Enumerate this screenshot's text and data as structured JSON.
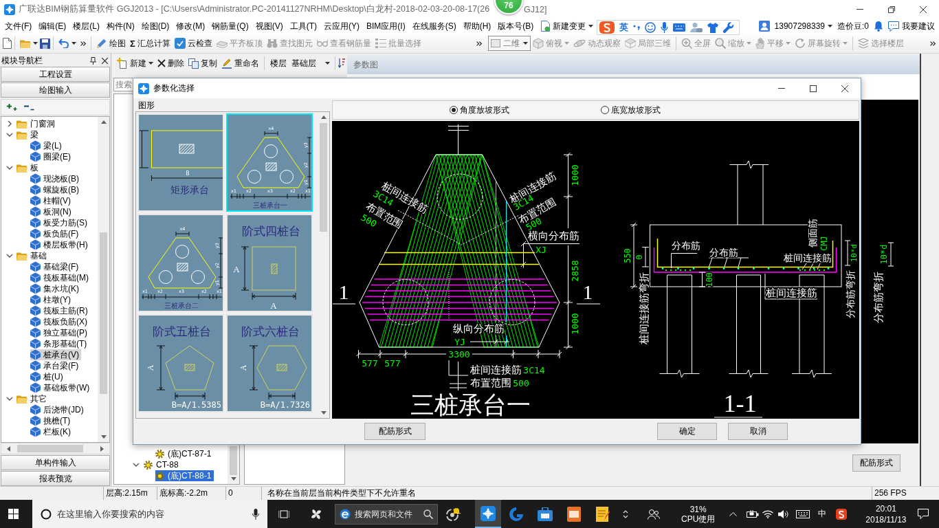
{
  "window": {
    "title": "广联达BIM钢筋算量软件 GGJ2013 - [C:\\Users\\Administrator.PC-20141127NRHM\\Desktop\\白龙村-2018-02-03-20-08-17(26",
    "title_tail": "GJ12]"
  },
  "score_badge": {
    "value": "76"
  },
  "menu": {
    "items": [
      "文件(F)",
      "编辑(E)",
      "楼层(L)",
      "构件(N)",
      "绘图(D)",
      "修改(M)",
      "钢筋量(Q)",
      "视图(V)",
      "工具(T)",
      "云应用(Y)",
      "BIM应用(I)",
      "在线服务(S)",
      "帮助(H)",
      "版本号(B)"
    ],
    "change": "新建变更"
  },
  "ime_toolbar": {
    "mode": "英"
  },
  "account": {
    "phone": "13907298339",
    "beans": "造价豆:0",
    "feedback": "我要建议"
  },
  "toolbar": {
    "main": [
      {
        "label": "绘图",
        "disabled": false
      },
      {
        "glyph": "Σ",
        "label": "汇总计算",
        "disabled": false
      },
      {
        "label": "云检查",
        "disabled": false
      },
      {
        "label": "平齐板顶",
        "disabled": true
      },
      {
        "label": "查找图元",
        "disabled": true
      },
      {
        "label": "查看钢筋量",
        "disabled": true
      },
      {
        "label": "批量选择",
        "disabled": true
      }
    ],
    "view_mode": {
      "value": "二维",
      "disabled": true
    },
    "view": [
      {
        "label": "俯视",
        "dropdown": true,
        "disabled": true
      },
      {
        "label": "动态观察",
        "dropdown": false,
        "disabled": true
      },
      {
        "label": "局部三维",
        "dropdown": false,
        "disabled": true
      },
      {
        "label": "全屏",
        "dropdown": false,
        "disabled": true
      },
      {
        "label": "缩放",
        "dropdown": true,
        "disabled": true
      },
      {
        "label": "平移",
        "dropdown": true,
        "disabled": true
      },
      {
        "label": "屏幕旋转",
        "dropdown": true,
        "disabled": true
      },
      {
        "label": "选择楼层",
        "dropdown": false,
        "disabled": true
      }
    ]
  },
  "nav": {
    "title": "模块导航栏",
    "top_buttons": [
      "工程设置",
      "绘图输入"
    ],
    "tree": [
      {
        "label": "门窗洞",
        "expanded": false
      },
      {
        "label": "梁",
        "expanded": true,
        "children": [
          {
            "label": "梁(L)",
            "selected": false
          },
          {
            "label": "圈梁(E)",
            "selected": false
          }
        ]
      },
      {
        "label": "板",
        "expanded": true,
        "children": [
          {
            "label": "现浇板(B)",
            "selected": false
          },
          {
            "label": "螺旋板(B)",
            "selected": false
          },
          {
            "label": "柱帽(V)",
            "selected": false
          },
          {
            "label": "板洞(N)",
            "selected": false
          },
          {
            "label": "板受力筋(S)",
            "selected": false
          },
          {
            "label": "板负筋(F)",
            "selected": false
          },
          {
            "label": "楼层板带(H)",
            "selected": false
          }
        ]
      },
      {
        "label": "基础",
        "expanded": true,
        "children": [
          {
            "label": "基础梁(F)",
            "selected": false
          },
          {
            "label": "筏板基础(M)",
            "selected": false
          },
          {
            "label": "集水坑(K)",
            "selected": false
          },
          {
            "label": "柱墩(Y)",
            "selected": false
          },
          {
            "label": "筏板主筋(R)",
            "selected": false
          },
          {
            "label": "筏板负筋(X)",
            "selected": false
          },
          {
            "label": "独立基础(P)",
            "selected": false
          },
          {
            "label": "条形基础(T)",
            "selected": false
          },
          {
            "label": "桩承台(V)",
            "selected": true
          },
          {
            "label": "承台梁(F)",
            "selected": false
          },
          {
            "label": "桩(U)",
            "selected": false
          },
          {
            "label": "基础板带(W)",
            "selected": false
          }
        ]
      },
      {
        "label": "其它",
        "expanded": true,
        "children": [
          {
            "label": "后浇带(JD)",
            "selected": false
          },
          {
            "label": "挑檐(T)",
            "selected": false
          },
          {
            "label": "栏板(K)",
            "selected": false
          }
        ]
      }
    ],
    "bottom_buttons": [
      "单构件输入",
      "报表预览"
    ]
  },
  "component_panel": {
    "toolbar": {
      "new": "新建",
      "delete": "删除",
      "copy": "复制",
      "rename": "重命名",
      "floor_label": "楼层",
      "floor": "基础层"
    },
    "search_placeholder": "搜索",
    "tree": [
      {
        "kind": "leaf",
        "label": "(底)CT-87-1",
        "selected": false
      },
      {
        "kind": "group",
        "label": "CT-88",
        "expanded": true,
        "children": [
          {
            "label": "(底)CT-88-1",
            "selected": true
          }
        ]
      }
    ]
  },
  "param_view": {
    "title": "参数图",
    "canvas_labels": [
      {
        "kind": "value",
        "text": "10*d"
      },
      {
        "kind": "note",
        "text": "分布筋弯折"
      }
    ],
    "button": "配筋形式"
  },
  "dialog": {
    "title": "参数化选择",
    "group": "图形",
    "shapes": [
      {
        "kind": "rect",
        "title": "矩形承台",
        "labels": [
          "B"
        ],
        "selected": false
      },
      {
        "kind": "triangle",
        "title": "三桩承台一",
        "labels": [
          "x4",
          "y3",
          "y2",
          "y1",
          "x1",
          "x2",
          "x3",
          "x2",
          "x1"
        ],
        "selected": true
      },
      {
        "kind": "triangle",
        "title": "三桩承台二",
        "labels": [
          "x4",
          "y3",
          "y2",
          "y1",
          "x1",
          "x2",
          "x3",
          "x2",
          "x1"
        ],
        "selected": false
      },
      {
        "kind": "square",
        "title": "阶式四桩台",
        "labels": [
          "A",
          "A"
        ],
        "selected": false
      },
      {
        "kind": "pentagon",
        "title": "阶式五桩台",
        "labels": [
          "A",
          "B=A/1.5385"
        ],
        "selected": false
      },
      {
        "kind": "hexagon",
        "title": "阶式六桩台",
        "labels": [
          "A",
          "B=A/1.7326"
        ],
        "selected": false
      }
    ],
    "slope_options": [
      {
        "label": "角度放坡形式",
        "selected": true
      },
      {
        "label": "底宽放坡形式",
        "selected": false
      }
    ],
    "plan": {
      "title": "三桩承台一",
      "labels": [
        {
          "kind": "note",
          "text": "桩间连接筋"
        },
        {
          "kind": "value",
          "text": "3C14"
        },
        {
          "kind": "note",
          "text": "布置范围"
        },
        {
          "kind": "value",
          "text": "500"
        },
        {
          "kind": "note",
          "text": "桩间连接筋"
        },
        {
          "kind": "value",
          "text": "3C14"
        },
        {
          "kind": "note",
          "text": "布置范围"
        },
        {
          "kind": "value",
          "text": "500"
        },
        {
          "kind": "value",
          "text": "1000"
        },
        {
          "kind": "value",
          "text": "2858"
        },
        {
          "kind": "value",
          "text": "1000"
        },
        {
          "kind": "note",
          "text": "横向分布筋"
        },
        {
          "kind": "value",
          "text": "XJ"
        },
        {
          "kind": "mark",
          "text": "1"
        },
        {
          "kind": "mark",
          "text": "1"
        },
        {
          "kind": "note",
          "text": "纵向分布筋"
        },
        {
          "kind": "value",
          "text": "YJ"
        },
        {
          "kind": "value",
          "text": "577"
        },
        {
          "kind": "value",
          "text": "577"
        },
        {
          "kind": "value",
          "text": "3300"
        },
        {
          "kind": "note",
          "text": "桩间连接筋"
        },
        {
          "kind": "value",
          "text": "3C14"
        },
        {
          "kind": "note",
          "text": "布置范围"
        },
        {
          "kind": "value",
          "text": "500"
        }
      ]
    },
    "section": {
      "title": "1-1",
      "labels": [
        {
          "kind": "value",
          "text": "550"
        },
        {
          "kind": "value",
          "text": "0"
        },
        {
          "kind": "value",
          "text": "100"
        },
        {
          "kind": "note",
          "text": "分布筋"
        },
        {
          "kind": "note",
          "text": "分布筋"
        },
        {
          "kind": "note",
          "text": "桩间连接筋"
        },
        {
          "kind": "note",
          "text": "侧面筋"
        },
        {
          "kind": "value",
          "text": "CMJ"
        },
        {
          "kind": "value",
          "text": "10*d"
        },
        {
          "kind": "note",
          "text": "桩间连接筋弯折"
        },
        {
          "kind": "note",
          "text": "桩间连接筋"
        },
        {
          "kind": "note",
          "text": "分布筋弯折"
        }
      ]
    },
    "buttons": {
      "rebar": "配筋形式",
      "ok": "确定",
      "cancel": "取消"
    }
  },
  "status_bar": [
    "层高:2.15m",
    "底标高:-2.2m",
    "0",
    "名称在当前层当前构件类型下不允许重名",
    "256 FPS"
  ],
  "taskbar": {
    "search_placeholder": "在这里输入你要搜索的内容",
    "web_search_placeholder": "搜索网页和文件",
    "cpu_value": "31%",
    "cpu_label": "CPU使用",
    "ime": "中",
    "time": "20:01",
    "date": "2018/11/13"
  }
}
